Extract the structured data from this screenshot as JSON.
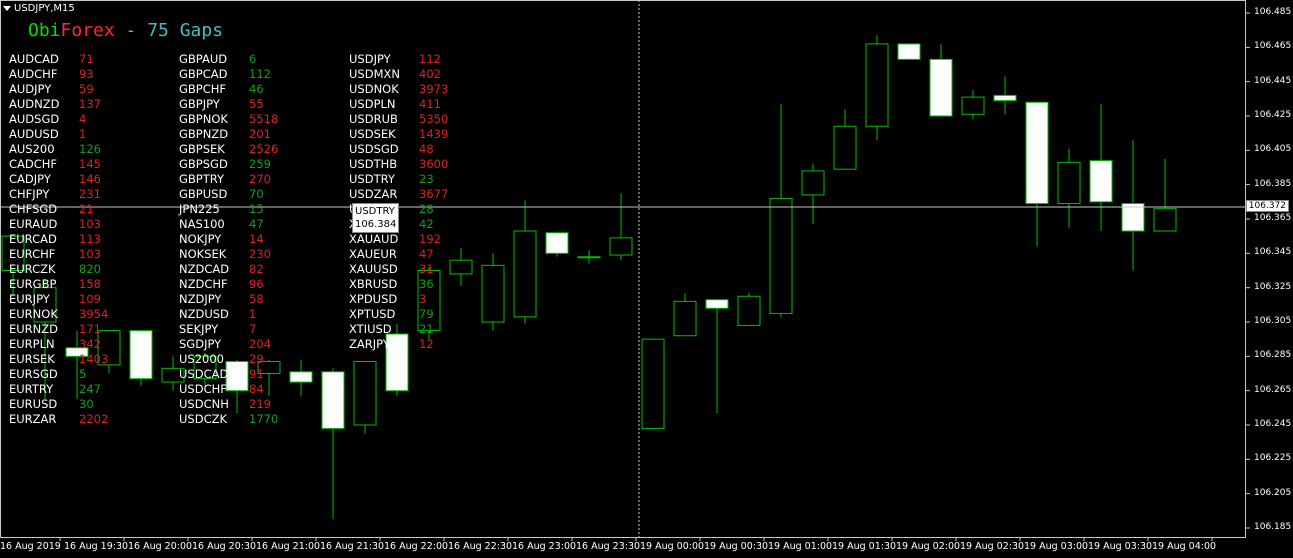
{
  "window": {
    "title": "USDJPY,M15"
  },
  "indicator": {
    "title_part1": "Obi",
    "title_part2": "Forex",
    "title_part3": " - 75 Gaps",
    "color_part1": "#00e000",
    "color_part2": "#ff2a2a",
    "color_part3": "#40c0c0"
  },
  "colors": {
    "up": "#ffffff",
    "candle_border": "#00c000",
    "red": "#e02020",
    "green": "#14a014",
    "grid": "#c8c8c8",
    "crosshair": "#c8c8c8"
  },
  "gaps": {
    "col1": [
      {
        "sym": "AUDCAD",
        "val": "71",
        "c": "red"
      },
      {
        "sym": "AUDCHF",
        "val": "93",
        "c": "red"
      },
      {
        "sym": "AUDJPY",
        "val": "59",
        "c": "red"
      },
      {
        "sym": "AUDNZD",
        "val": "137",
        "c": "red"
      },
      {
        "sym": "AUDSGD",
        "val": "4",
        "c": "red"
      },
      {
        "sym": "AUDUSD",
        "val": "1",
        "c": "red"
      },
      {
        "sym": "AUS200",
        "val": "126",
        "c": "green"
      },
      {
        "sym": "CADCHF",
        "val": "145",
        "c": "red"
      },
      {
        "sym": "CADJPY",
        "val": "146",
        "c": "red"
      },
      {
        "sym": "CHFJPY",
        "val": "231",
        "c": "red"
      },
      {
        "sym": "CHFSGD",
        "val": "21",
        "c": "red"
      },
      {
        "sym": "EURAUD",
        "val": "103",
        "c": "red"
      },
      {
        "sym": "EURCAD",
        "val": "113",
        "c": "red"
      },
      {
        "sym": "EURCHF",
        "val": "103",
        "c": "red"
      },
      {
        "sym": "EURCZK",
        "val": "820",
        "c": "green"
      },
      {
        "sym": "EURGBP",
        "val": "158",
        "c": "red"
      },
      {
        "sym": "EURJPY",
        "val": "109",
        "c": "red"
      },
      {
        "sym": "EURNOK",
        "val": "3954",
        "c": "red"
      },
      {
        "sym": "EURNZD",
        "val": "171",
        "c": "red"
      },
      {
        "sym": "EURPLN",
        "val": "342",
        "c": "red"
      },
      {
        "sym": "EURSEK",
        "val": "1403",
        "c": "red"
      },
      {
        "sym": "EURSGD",
        "val": "5",
        "c": "green"
      },
      {
        "sym": "EURTRY",
        "val": "247",
        "c": "green"
      },
      {
        "sym": "EURUSD",
        "val": "30",
        "c": "green"
      },
      {
        "sym": "EURZAR",
        "val": "2202",
        "c": "red"
      }
    ],
    "col2": [
      {
        "sym": "GBPAUD",
        "val": "6",
        "c": "green"
      },
      {
        "sym": "GBPCAD",
        "val": "112",
        "c": "green"
      },
      {
        "sym": "GBPCHF",
        "val": "46",
        "c": "green"
      },
      {
        "sym": "GBPJPY",
        "val": "55",
        "c": "red"
      },
      {
        "sym": "GBPNOK",
        "val": "5518",
        "c": "red"
      },
      {
        "sym": "GBPNZD",
        "val": "201",
        "c": "red"
      },
      {
        "sym": "GBPSEK",
        "val": "2526",
        "c": "red"
      },
      {
        "sym": "GBPSGD",
        "val": "259",
        "c": "green"
      },
      {
        "sym": "GBPTRY",
        "val": "270",
        "c": "red"
      },
      {
        "sym": "GBPUSD",
        "val": "70",
        "c": "green"
      },
      {
        "sym": "JPN225",
        "val": "15",
        "c": "green"
      },
      {
        "sym": "NAS100",
        "val": "47",
        "c": "green"
      },
      {
        "sym": "NOKJPY",
        "val": "14",
        "c": "red"
      },
      {
        "sym": "NOKSEK",
        "val": "230",
        "c": "red"
      },
      {
        "sym": "NZDCAD",
        "val": "82",
        "c": "red"
      },
      {
        "sym": "NZDCHF",
        "val": "96",
        "c": "red"
      },
      {
        "sym": "NZDJPY",
        "val": "58",
        "c": "red"
      },
      {
        "sym": "NZDUSD",
        "val": "1",
        "c": "red"
      },
      {
        "sym": "SEKJPY",
        "val": "7",
        "c": "red"
      },
      {
        "sym": "SGDJPY",
        "val": "204",
        "c": "red"
      },
      {
        "sym": "US2000",
        "val": "29",
        "c": "red"
      },
      {
        "sym": "USDCAD",
        "val": "91",
        "c": "red"
      },
      {
        "sym": "USDCHF",
        "val": "84",
        "c": "red"
      },
      {
        "sym": "USDCNH",
        "val": "219",
        "c": "red"
      },
      {
        "sym": "USDCZK",
        "val": "1770",
        "c": "green"
      }
    ],
    "col3": [
      {
        "sym": "USDJPY",
        "val": "112",
        "c": "red"
      },
      {
        "sym": "USDMXN",
        "val": "402",
        "c": "red"
      },
      {
        "sym": "USDNOK",
        "val": "3973",
        "c": "red"
      },
      {
        "sym": "USDPLN",
        "val": "411",
        "c": "red"
      },
      {
        "sym": "USDRUB",
        "val": "5350",
        "c": "red"
      },
      {
        "sym": "USDSEK",
        "val": "1439",
        "c": "red"
      },
      {
        "sym": "USDSGD",
        "val": "48",
        "c": "red"
      },
      {
        "sym": "USDTHB",
        "val": "3600",
        "c": "red"
      },
      {
        "sym": "USDTRY",
        "val": "23",
        "c": "green"
      },
      {
        "sym": "USDZAR",
        "val": "3677",
        "c": "red"
      },
      {
        "sym": "USDTRY",
        "val": "28",
        "c": "green"
      },
      {
        "sym": "XAUCHF",
        "val": "42",
        "c": "green"
      },
      {
        "sym": "XAUAUD",
        "val": "192",
        "c": "red"
      },
      {
        "sym": "XAUEUR",
        "val": "47",
        "c": "red"
      },
      {
        "sym": "XAUUSD",
        "val": "31",
        "c": "red"
      },
      {
        "sym": "XBRUSD",
        "val": "36",
        "c": "green"
      },
      {
        "sym": "XPDUSD",
        "val": "3",
        "c": "red"
      },
      {
        "sym": "XPTUSD",
        "val": "79",
        "c": "green"
      },
      {
        "sym": "XTIUSD",
        "val": "21",
        "c": "green"
      },
      {
        "sym": "ZARJPY",
        "val": "12",
        "c": "red"
      }
    ]
  },
  "crosshair": {
    "label_symbol": "USDTRY",
    "label_price": "106.384",
    "price_label": "106.372"
  },
  "chart_data": {
    "type": "candlestick",
    "symbol": "USDJPY",
    "timeframe": "M15",
    "ylim": [
      106.175,
      106.495
    ],
    "price_ticks": [
      "106.485",
      "106.465",
      "106.445",
      "106.425",
      "106.405",
      "106.385",
      "106.365",
      "106.345",
      "106.325",
      "106.305",
      "106.285",
      "106.265",
      "106.245",
      "106.225",
      "106.205",
      "106.185"
    ],
    "time_labels": [
      "16 Aug 2019",
      "16 Aug 19:30",
      "16 Aug 20:00",
      "16 Aug 20:30",
      "16 Aug 21:00",
      "16 Aug 21:30",
      "16 Aug 22:00",
      "16 Aug 22:30",
      "16 Aug 23:00",
      "16 Aug 23:30",
      "19 Aug 00:00",
      "19 Aug 00:30",
      "19 Aug 01:00",
      "19 Aug 01:30",
      "19 Aug 02:00",
      "19 Aug 02:30",
      "19 Aug 03:00",
      "19 Aug 03:30",
      "19 Aug 04:00"
    ],
    "candles": [
      {
        "o": 106.335,
        "h": 106.34,
        "c": 106.355,
        "l": 106.32
      },
      {
        "o": 106.305,
        "h": 106.33,
        "c": 106.325,
        "l": 106.26
      },
      {
        "o": 106.29,
        "h": 106.3,
        "c": 106.285,
        "l": 106.26
      },
      {
        "o": 106.28,
        "h": 106.3,
        "c": 106.3,
        "l": 106.275
      },
      {
        "o": 106.3,
        "h": 106.3,
        "c": 106.272,
        "l": 106.268
      },
      {
        "o": 106.27,
        "h": 106.285,
        "c": 106.278,
        "l": 106.265
      },
      {
        "o": 106.272,
        "h": 106.287,
        "c": 106.285,
        "l": 106.265
      },
      {
        "o": 106.282,
        "h": 106.283,
        "c": 106.265,
        "l": 106.252
      },
      {
        "o": 106.275,
        "h": 106.283,
        "c": 106.282,
        "l": 106.262
      },
      {
        "o": 106.276,
        "h": 106.283,
        "c": 106.27,
        "l": 106.262
      },
      {
        "o": 106.276,
        "h": 106.278,
        "c": 106.243,
        "l": 106.19
      },
      {
        "o": 106.245,
        "h": 106.28,
        "c": 106.282,
        "l": 106.24
      },
      {
        "o": 106.298,
        "h": 106.304,
        "c": 106.265,
        "l": 106.262
      },
      {
        "o": 106.3,
        "h": 106.337,
        "c": 106.335,
        "l": 106.295
      },
      {
        "o": 106.333,
        "h": 106.348,
        "c": 106.341,
        "l": 106.326
      },
      {
        "o": 106.305,
        "h": 106.345,
        "c": 106.338,
        "l": 106.3
      },
      {
        "o": 106.308,
        "h": 106.376,
        "c": 106.358,
        "l": 106.304
      },
      {
        "o": 106.357,
        "h": 106.357,
        "c": 106.345,
        "l": 106.343
      },
      {
        "o": 106.343,
        "h": 106.347,
        "c": 106.343,
        "l": 106.339
      },
      {
        "o": 106.344,
        "h": 106.38,
        "c": 106.354,
        "l": 106.341
      },
      {
        "o": 106.243,
        "h": 106.295,
        "c": 106.295,
        "l": 106.243
      },
      {
        "o": 106.297,
        "h": 106.322,
        "c": 106.317,
        "l": 106.297
      },
      {
        "o": 106.318,
        "h": 106.318,
        "c": 106.313,
        "l": 106.252
      },
      {
        "o": 106.303,
        "h": 106.322,
        "c": 106.32,
        "l": 106.303
      },
      {
        "o": 106.31,
        "h": 106.432,
        "c": 106.377,
        "l": 106.308
      },
      {
        "o": 106.379,
        "h": 106.397,
        "c": 106.393,
        "l": 106.362
      },
      {
        "o": 106.394,
        "h": 106.429,
        "c": 106.419,
        "l": 106.394
      },
      {
        "o": 106.419,
        "h": 106.472,
        "c": 106.467,
        "l": 106.411
      },
      {
        "o": 106.467,
        "h": 106.467,
        "c": 106.458,
        "l": 106.458
      },
      {
        "o": 106.458,
        "h": 106.467,
        "c": 106.425,
        "l": 106.425
      },
      {
        "o": 106.426,
        "h": 106.44,
        "c": 106.436,
        "l": 106.423
      },
      {
        "o": 106.437,
        "h": 106.448,
        "c": 106.434,
        "l": 106.426
      },
      {
        "o": 106.433,
        "h": 106.433,
        "c": 106.374,
        "l": 106.349
      },
      {
        "o": 106.374,
        "h": 106.406,
        "c": 106.398,
        "l": 106.36
      },
      {
        "o": 106.399,
        "h": 106.432,
        "c": 106.375,
        "l": 106.358
      },
      {
        "o": 106.374,
        "h": 106.411,
        "c": 106.358,
        "l": 106.335
      },
      {
        "o": 106.358,
        "h": 106.4,
        "c": 106.371,
        "l": 106.358
      }
    ]
  }
}
